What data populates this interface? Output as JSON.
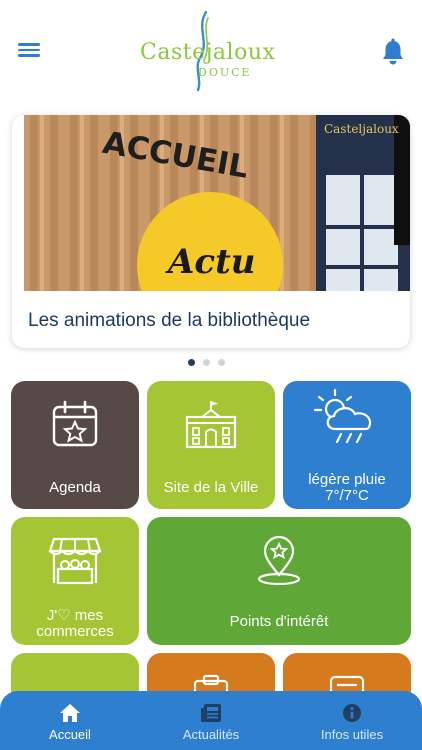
{
  "header": {
    "logo_main": "Castejaloux",
    "logo_sub": "DOUCE"
  },
  "news": {
    "image_sign": "ACCUEIL",
    "image_badge": "Actu",
    "image_brand": "Casteljaloux",
    "title": "Les animations de la bibliothèque",
    "page_count": 3,
    "active_page": 1
  },
  "tiles": {
    "agenda": "Agenda",
    "site": "Site de la Ville",
    "weather_desc": "légère pluie",
    "weather_temp": "7°/7°C",
    "commerces_line1": "J'♡ mes",
    "commerces_line2": "commerces",
    "points": "Points d'intérêt"
  },
  "tabbar": {
    "home": "Accueil",
    "news": "Actualités",
    "info": "Infos utiles"
  },
  "colors": {
    "accent_blue": "#2f7fd0",
    "lime": "#a5c634",
    "green": "#5fa737",
    "dark": "#574a46",
    "orange": "#d57a1d",
    "title_navy": "#1c3a5c"
  }
}
